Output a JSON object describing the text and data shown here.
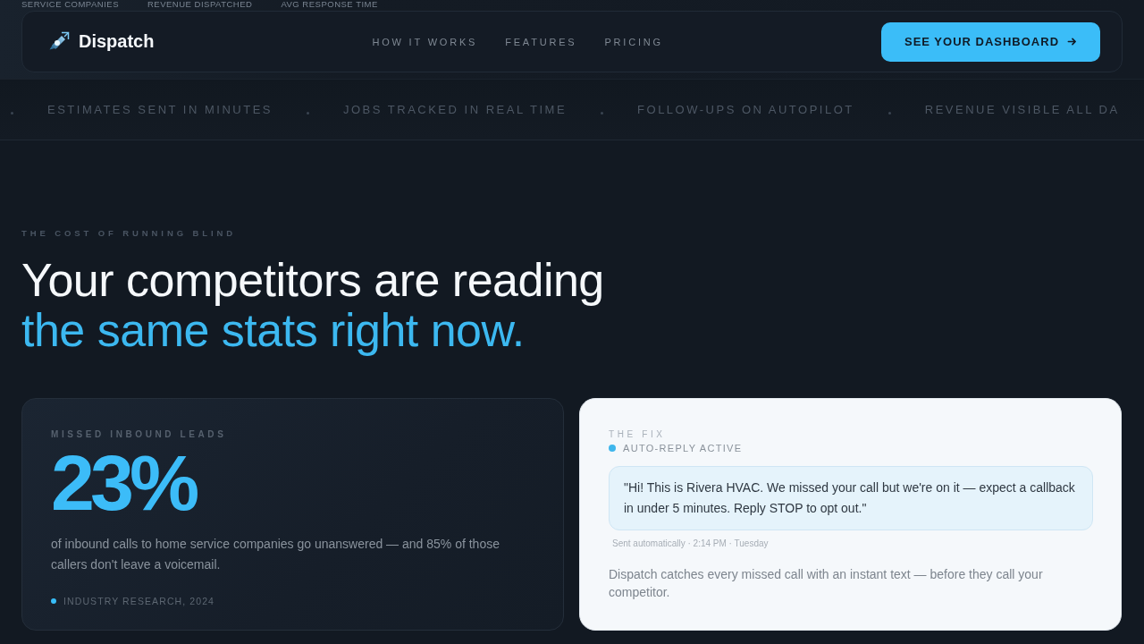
{
  "stats_strip": [
    "SERVICE COMPANIES",
    "REVENUE DISPATCHED",
    "AVG RESPONSE TIME"
  ],
  "nav": {
    "brand": "Dispatch",
    "links": [
      "HOW IT WORKS",
      "FEATURES",
      "PRICING"
    ],
    "cta": "SEE YOUR DASHBOARD"
  },
  "marquee": [
    "ESTIMATES SENT IN MINUTES",
    "JOBS TRACKED IN REAL TIME",
    "FOLLOW-UPS ON AUTOPILOT",
    "REVENUE VISIBLE ALL DA"
  ],
  "section": {
    "eyebrow": "THE COST OF RUNNING BLIND",
    "headline": "Your competitors are reading",
    "headline_accent": "the same stats right now."
  },
  "problem_card": {
    "eyebrow": "MISSED INBOUND LEADS",
    "stat": "23%",
    "description": "of inbound calls to home service companies go unanswered — and 85% of those callers don't leave a voicemail.",
    "source": "INDUSTRY RESEARCH, 2024"
  },
  "fix_card": {
    "eyebrow": "THE FIX",
    "status": "AUTO-REPLY ACTIVE",
    "message": "\"Hi! This is Rivera HVAC. We missed your call but we're on it — expect a callback in under 5 minutes. Reply STOP to opt out.\"",
    "meta": "Sent automatically · 2:14 PM · Tuesday",
    "description": "Dispatch catches every missed call with an instant text — before they call your competitor."
  }
}
